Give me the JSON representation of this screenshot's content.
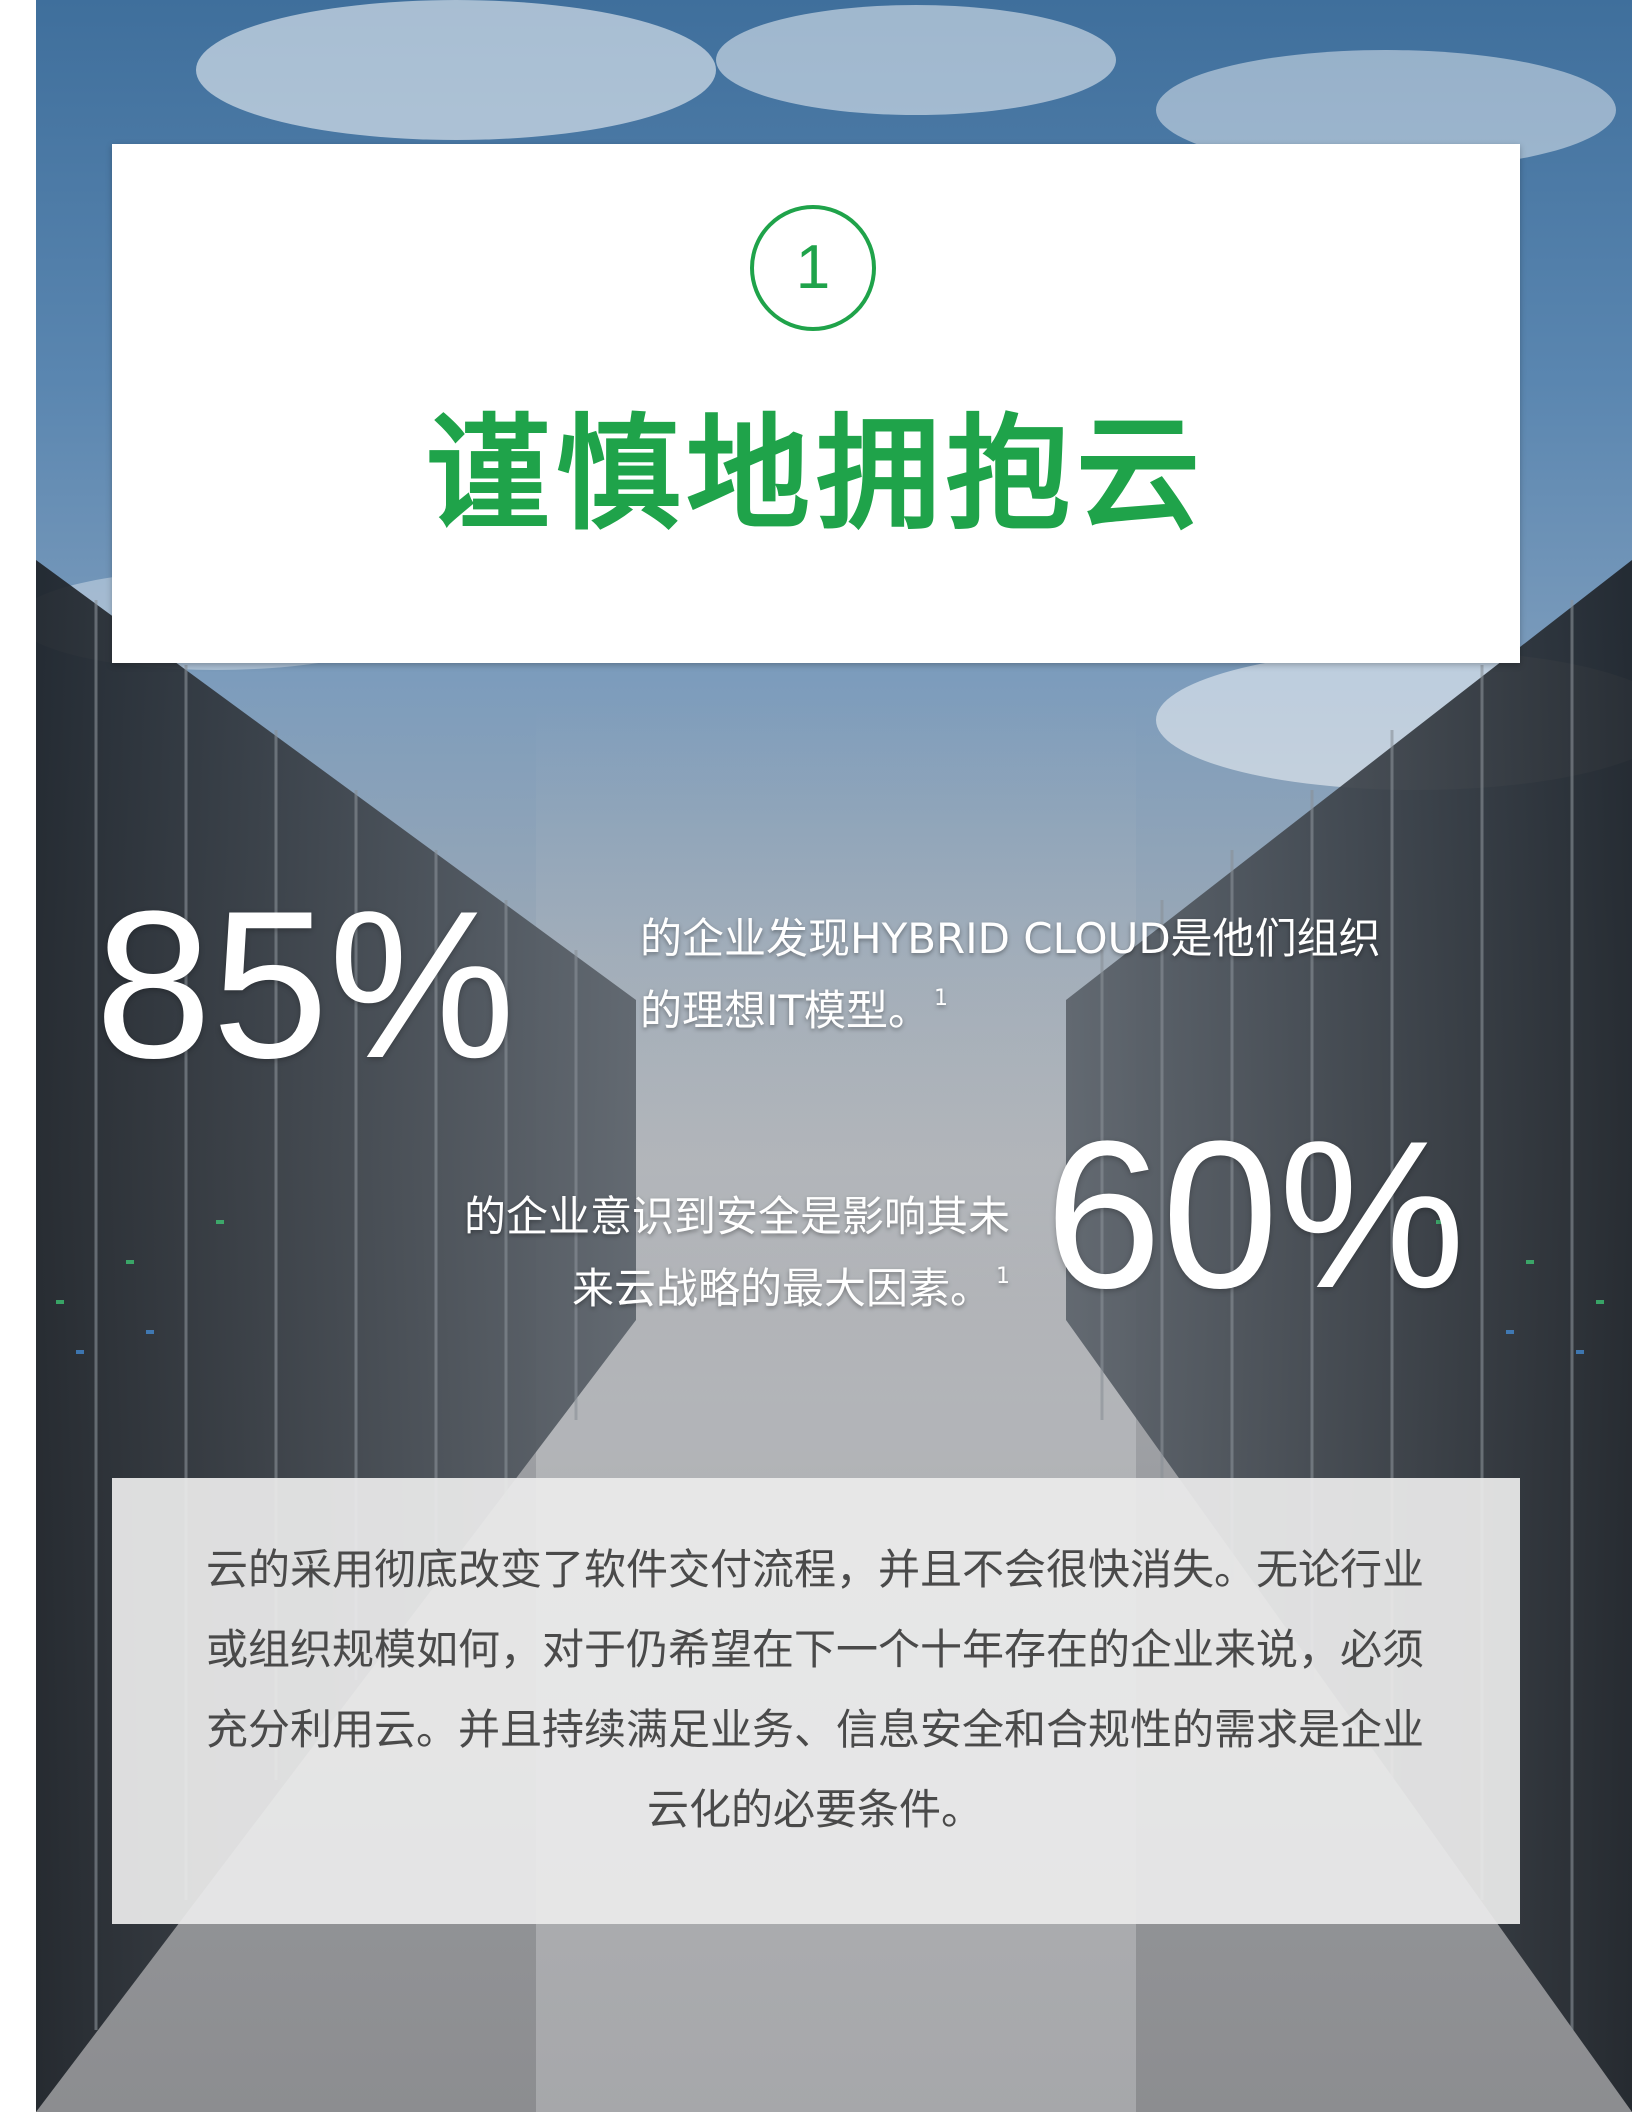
{
  "header": {
    "section_number": "1",
    "title": "谨慎地拥抱云"
  },
  "stats": [
    {
      "value": "85%",
      "line1": "的企业发现HYBRID CLOUD是他们组织",
      "line2": "的理想IT模型。",
      "footnote": "1"
    },
    {
      "value": "60%",
      "line1": "的企业意识到安全是影响其未",
      "line2": "来云战略的最大因素。",
      "footnote": "1"
    }
  ],
  "body": {
    "paragraph": "云的采用彻底改变了软件交付流程，并且不会很快消失。无论行业或组织规模如何，对于仍希望在下一个十年存在的企业来说，必须充分利用云。并且持续满足业务、信息安全和合规性的需求是企业云化的必要条件。"
  },
  "colors": {
    "accent": "#1fa34a",
    "body_text": "#4a4a4a",
    "stat_text": "#ffffff"
  }
}
